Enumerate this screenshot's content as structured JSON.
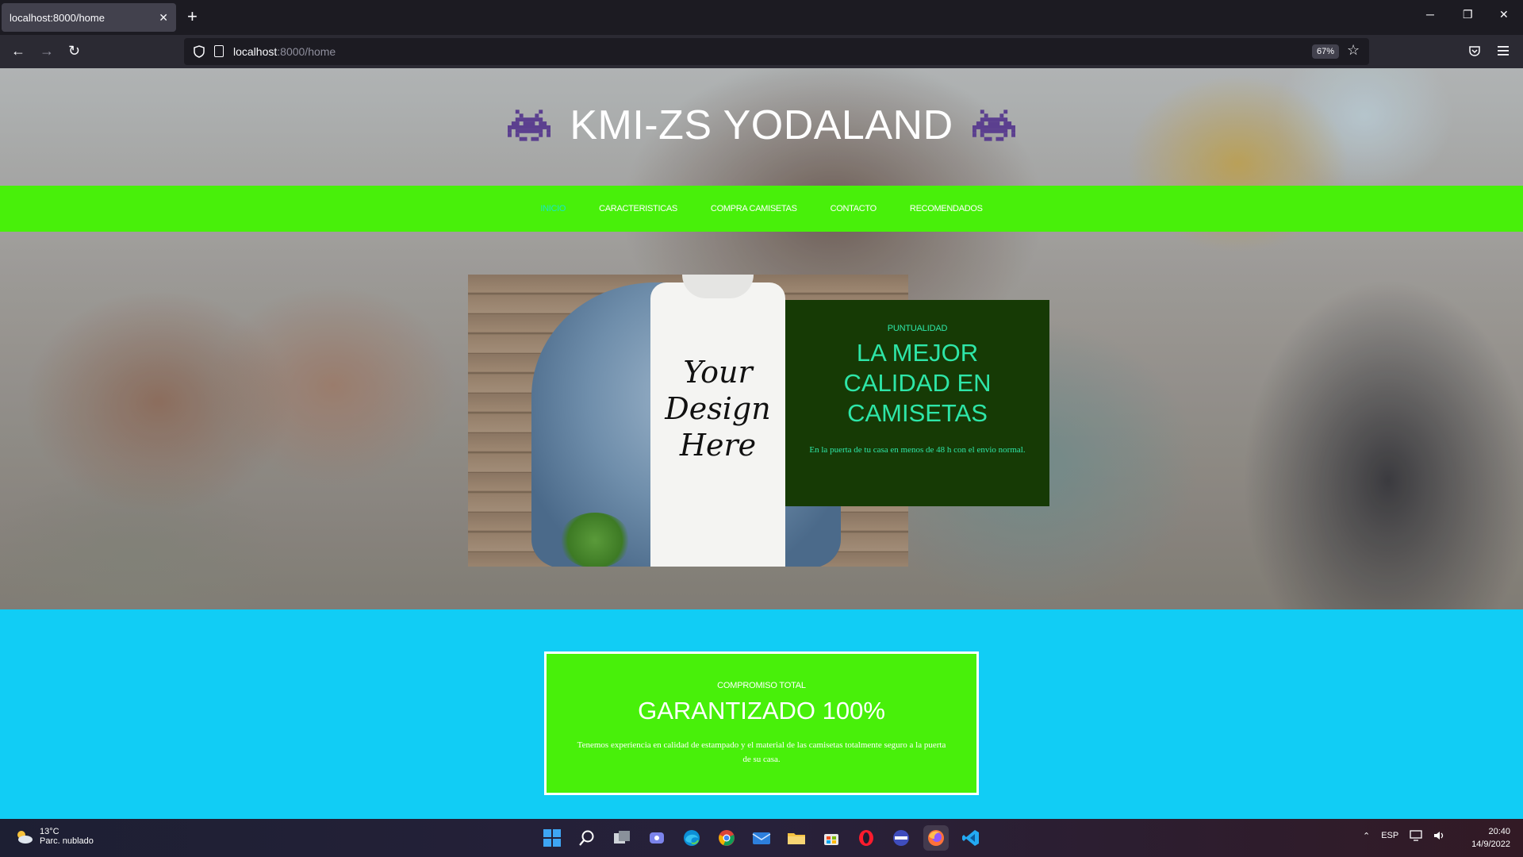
{
  "browser": {
    "tab_title": "localhost:8000/home",
    "tab_close": "✕",
    "new_tab": "+",
    "url_host": "localhost",
    "url_rest": ":8000/home",
    "zoom": "67%",
    "minimize": "─",
    "restore": "❐",
    "close": "✕",
    "back": "←",
    "forward": "→",
    "reload": "↻",
    "star": "☆"
  },
  "site": {
    "title": "KMI-ZS YODALAND",
    "invader_color": "#5b3f8f",
    "nav": [
      {
        "label": "INICIO",
        "active": true
      },
      {
        "label": "CARACTERISTICAS"
      },
      {
        "label": "COMPRA CAMISETAS"
      },
      {
        "label": "CONTACTO"
      },
      {
        "label": "RECOMENDADOS"
      }
    ],
    "promo_image_text": "Your Design Here",
    "feature": {
      "kicker": "PUNTUALIDAD",
      "title": "LA MEJOR CALIDAD EN CAMISETAS",
      "text": "En la puerta de tu casa en menos de 48 h con el envio normal."
    },
    "guarantee": {
      "kicker": "COMPROMISO TOTAL",
      "title": "GARANTIZADO 100%",
      "text": "Tenemos experiencia en calidad de estampado y el material de las camisetas totalmente seguro a la puerta de su casa."
    },
    "colors": {
      "menu_bg": "#48f00a",
      "menu_active": "#19e6c8",
      "feature_bg": "#163a05",
      "feature_text": "#2ee6a8",
      "section_bg": "#11cdf5"
    }
  },
  "taskbar": {
    "weather_temp": "13°C",
    "weather_desc": "Parc. nublado",
    "lang": "ESP",
    "time": "20:40",
    "date": "14/9/2022",
    "apps": [
      "windows-start-icon",
      "search-icon",
      "task-view-icon",
      "chat-icon",
      "edge-icon",
      "chrome-icon",
      "mail-icon",
      "file-explorer-icon",
      "store-icon",
      "opera-icon",
      "app-icon",
      "firefox-icon",
      "vscode-icon"
    ]
  }
}
